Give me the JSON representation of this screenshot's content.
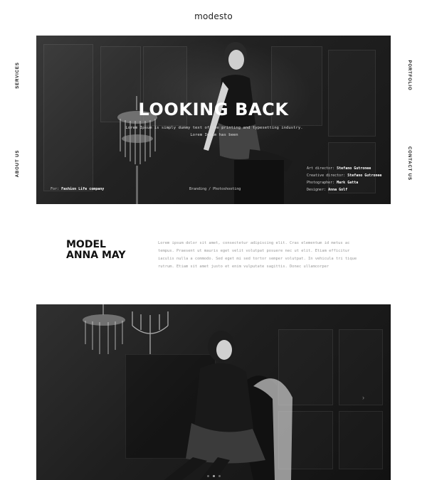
{
  "brand": {
    "logo": "modesto"
  },
  "nav": {
    "services": "SERVICES",
    "about": "ABOUT US",
    "portfolio": "PORTFOLIO",
    "contact": "CONTACT US"
  },
  "hero": {
    "title": "LOOKING BACK",
    "subtitle_line1": "Lorem Ipsum is simply dummy text of the printing and typesetting industry.",
    "subtitle_line2": "Lorem Ipsum has been",
    "for_label": "For:",
    "for_value": "Fashion Life company",
    "services": "Branding / Photoshooting",
    "credits": [
      {
        "label": "Art director:",
        "value": "Stefano Gutronee"
      },
      {
        "label": "Creative director:",
        "value": "Stefano Gutronee"
      },
      {
        "label": "Photographer:",
        "value": "Mark Gatta"
      },
      {
        "label": "Designer:",
        "value": "Anna Golf"
      }
    ]
  },
  "model": {
    "title_line1": "MODEL",
    "title_line2": "ANNA MAY",
    "description": "Lorem ipsum dolor sit amet, consectetur adipiscing elit. Cras elementum id metus ac tempus. Praesent ut mauris eget velit volutpat posuere nec ut elit. Etiam efficitur iaculis nulla a commodo. Sed eget mi sed tortor semper volutpat. In vehicula tri tique rutrum. Etiam sit amet justo et enim vulputate sagittis. Donec ullamcorper"
  },
  "gallery": {
    "next_icon": "chevron-right-icon",
    "slides": 3,
    "active_slide": 2
  }
}
